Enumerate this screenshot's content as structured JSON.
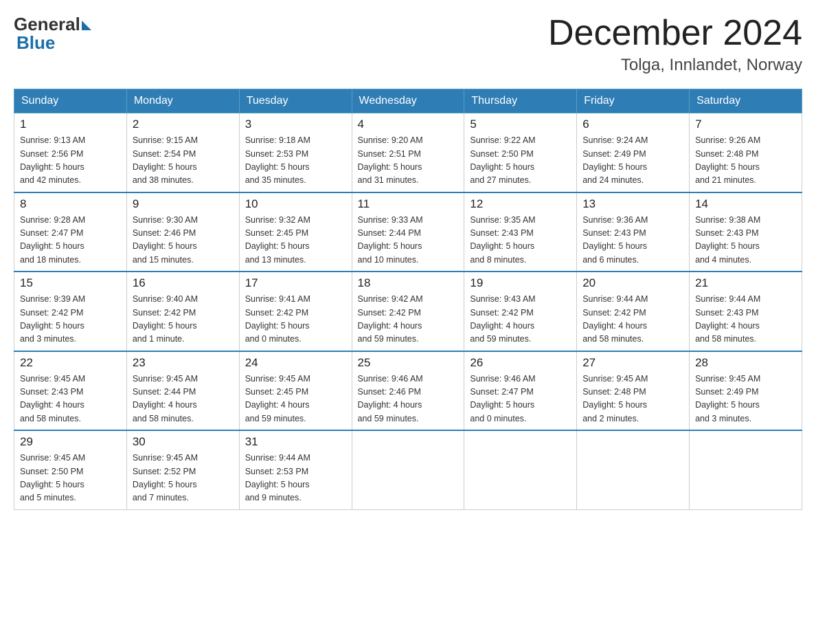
{
  "header": {
    "logo_general": "General",
    "logo_blue": "Blue",
    "month_title": "December 2024",
    "location": "Tolga, Innlandet, Norway"
  },
  "days_of_week": [
    "Sunday",
    "Monday",
    "Tuesday",
    "Wednesday",
    "Thursday",
    "Friday",
    "Saturday"
  ],
  "weeks": [
    [
      {
        "day": "1",
        "sunrise": "9:13 AM",
        "sunset": "2:56 PM",
        "daylight": "5 hours and 42 minutes."
      },
      {
        "day": "2",
        "sunrise": "9:15 AM",
        "sunset": "2:54 PM",
        "daylight": "5 hours and 38 minutes."
      },
      {
        "day": "3",
        "sunrise": "9:18 AM",
        "sunset": "2:53 PM",
        "daylight": "5 hours and 35 minutes."
      },
      {
        "day": "4",
        "sunrise": "9:20 AM",
        "sunset": "2:51 PM",
        "daylight": "5 hours and 31 minutes."
      },
      {
        "day": "5",
        "sunrise": "9:22 AM",
        "sunset": "2:50 PM",
        "daylight": "5 hours and 27 minutes."
      },
      {
        "day": "6",
        "sunrise": "9:24 AM",
        "sunset": "2:49 PM",
        "daylight": "5 hours and 24 minutes."
      },
      {
        "day": "7",
        "sunrise": "9:26 AM",
        "sunset": "2:48 PM",
        "daylight": "5 hours and 21 minutes."
      }
    ],
    [
      {
        "day": "8",
        "sunrise": "9:28 AM",
        "sunset": "2:47 PM",
        "daylight": "5 hours and 18 minutes."
      },
      {
        "day": "9",
        "sunrise": "9:30 AM",
        "sunset": "2:46 PM",
        "daylight": "5 hours and 15 minutes."
      },
      {
        "day": "10",
        "sunrise": "9:32 AM",
        "sunset": "2:45 PM",
        "daylight": "5 hours and 13 minutes."
      },
      {
        "day": "11",
        "sunrise": "9:33 AM",
        "sunset": "2:44 PM",
        "daylight": "5 hours and 10 minutes."
      },
      {
        "day": "12",
        "sunrise": "9:35 AM",
        "sunset": "2:43 PM",
        "daylight": "5 hours and 8 minutes."
      },
      {
        "day": "13",
        "sunrise": "9:36 AM",
        "sunset": "2:43 PM",
        "daylight": "5 hours and 6 minutes."
      },
      {
        "day": "14",
        "sunrise": "9:38 AM",
        "sunset": "2:43 PM",
        "daylight": "5 hours and 4 minutes."
      }
    ],
    [
      {
        "day": "15",
        "sunrise": "9:39 AM",
        "sunset": "2:42 PM",
        "daylight": "5 hours and 3 minutes."
      },
      {
        "day": "16",
        "sunrise": "9:40 AM",
        "sunset": "2:42 PM",
        "daylight": "5 hours and 1 minute."
      },
      {
        "day": "17",
        "sunrise": "9:41 AM",
        "sunset": "2:42 PM",
        "daylight": "5 hours and 0 minutes."
      },
      {
        "day": "18",
        "sunrise": "9:42 AM",
        "sunset": "2:42 PM",
        "daylight": "4 hours and 59 minutes."
      },
      {
        "day": "19",
        "sunrise": "9:43 AM",
        "sunset": "2:42 PM",
        "daylight": "4 hours and 59 minutes."
      },
      {
        "day": "20",
        "sunrise": "9:44 AM",
        "sunset": "2:42 PM",
        "daylight": "4 hours and 58 minutes."
      },
      {
        "day": "21",
        "sunrise": "9:44 AM",
        "sunset": "2:43 PM",
        "daylight": "4 hours and 58 minutes."
      }
    ],
    [
      {
        "day": "22",
        "sunrise": "9:45 AM",
        "sunset": "2:43 PM",
        "daylight": "4 hours and 58 minutes."
      },
      {
        "day": "23",
        "sunrise": "9:45 AM",
        "sunset": "2:44 PM",
        "daylight": "4 hours and 58 minutes."
      },
      {
        "day": "24",
        "sunrise": "9:45 AM",
        "sunset": "2:45 PM",
        "daylight": "4 hours and 59 minutes."
      },
      {
        "day": "25",
        "sunrise": "9:46 AM",
        "sunset": "2:46 PM",
        "daylight": "4 hours and 59 minutes."
      },
      {
        "day": "26",
        "sunrise": "9:46 AM",
        "sunset": "2:47 PM",
        "daylight": "5 hours and 0 minutes."
      },
      {
        "day": "27",
        "sunrise": "9:45 AM",
        "sunset": "2:48 PM",
        "daylight": "5 hours and 2 minutes."
      },
      {
        "day": "28",
        "sunrise": "9:45 AM",
        "sunset": "2:49 PM",
        "daylight": "5 hours and 3 minutes."
      }
    ],
    [
      {
        "day": "29",
        "sunrise": "9:45 AM",
        "sunset": "2:50 PM",
        "daylight": "5 hours and 5 minutes."
      },
      {
        "day": "30",
        "sunrise": "9:45 AM",
        "sunset": "2:52 PM",
        "daylight": "5 hours and 7 minutes."
      },
      {
        "day": "31",
        "sunrise": "9:44 AM",
        "sunset": "2:53 PM",
        "daylight": "5 hours and 9 minutes."
      },
      null,
      null,
      null,
      null
    ]
  ],
  "labels": {
    "sunrise": "Sunrise:",
    "sunset": "Sunset:",
    "daylight": "Daylight:"
  }
}
